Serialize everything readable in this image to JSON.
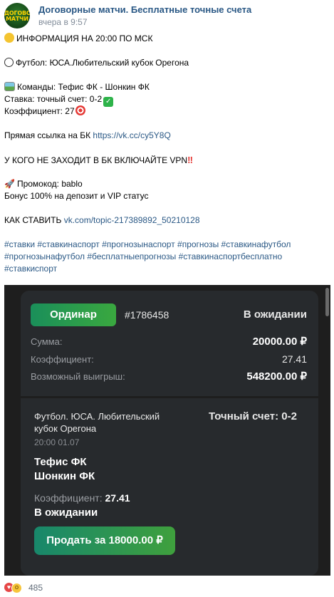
{
  "header": {
    "avatar_text": "ДОГОВОРНЫЕ МАТЧИ",
    "channel_name": "Договорные матчи. Бесплатные точные счета",
    "time": "вчера в 9:57"
  },
  "post": {
    "info": "ИНФОРМАЦИЯ НА 20:00 ПО МСК",
    "football": "Футбол: ЮСА.Любительский кубок Орегона",
    "teams": "Команды: Тефис ФК - Шонкин ФК",
    "stake": "Ставка: точный счет: 0-2",
    "coef": "Коэффициент: 27",
    "link_label": "Прямая ссылка на БК ",
    "link_url": "https://vk.cc/cy5Y8Q",
    "vpn": "У КОГО НЕ ЗАХОДИТ В БК ВКЛЮЧАЙТЕ VPN",
    "promo": "Промокод: bablo",
    "bonus": "Бонус 100% на депозит и VIP статус",
    "how_label": "КАК СТАВИТЬ ",
    "how_url": "vk.com/topic-217389892_50210128",
    "hashtags_1": "#ставки #ставкинаспорт #прогнозынаспорт #прогнозы #ставкинафутбол",
    "hashtags_2": "#прогнозынафутбол #бесплатныепрогнозы #ставкинаспортбесплатно",
    "hashtags_3": "#ставкиспорт"
  },
  "bet_card": {
    "type_button": "Ординар",
    "bet_id": "#1786458",
    "status": "В ожидании",
    "sum_label": "Сумма:",
    "sum_value": "20000.00 ₽",
    "coef_label": "Коэффициент:",
    "coef_value": "27.41",
    "win_label": "Возможный выигрыш:",
    "win_value": "548200.00 ₽",
    "event": "Футбол. ЮСА. Любительский кубок Орегона",
    "selection": "Точный счет: 0-2",
    "event_time": "20:00 01.07",
    "team1": "Тефис ФК",
    "team2": "Шонкин ФК",
    "event_coef_label": "Коэффициент: ",
    "event_coef_value": "27.41",
    "event_status": "В ожидании",
    "sell_button": "Продать за 18000.00 ₽"
  },
  "reactions": {
    "count": "485"
  },
  "colors": {
    "link": "#2a5885",
    "card_bg": "#272a2d",
    "accent_green": "#3aa83f"
  }
}
